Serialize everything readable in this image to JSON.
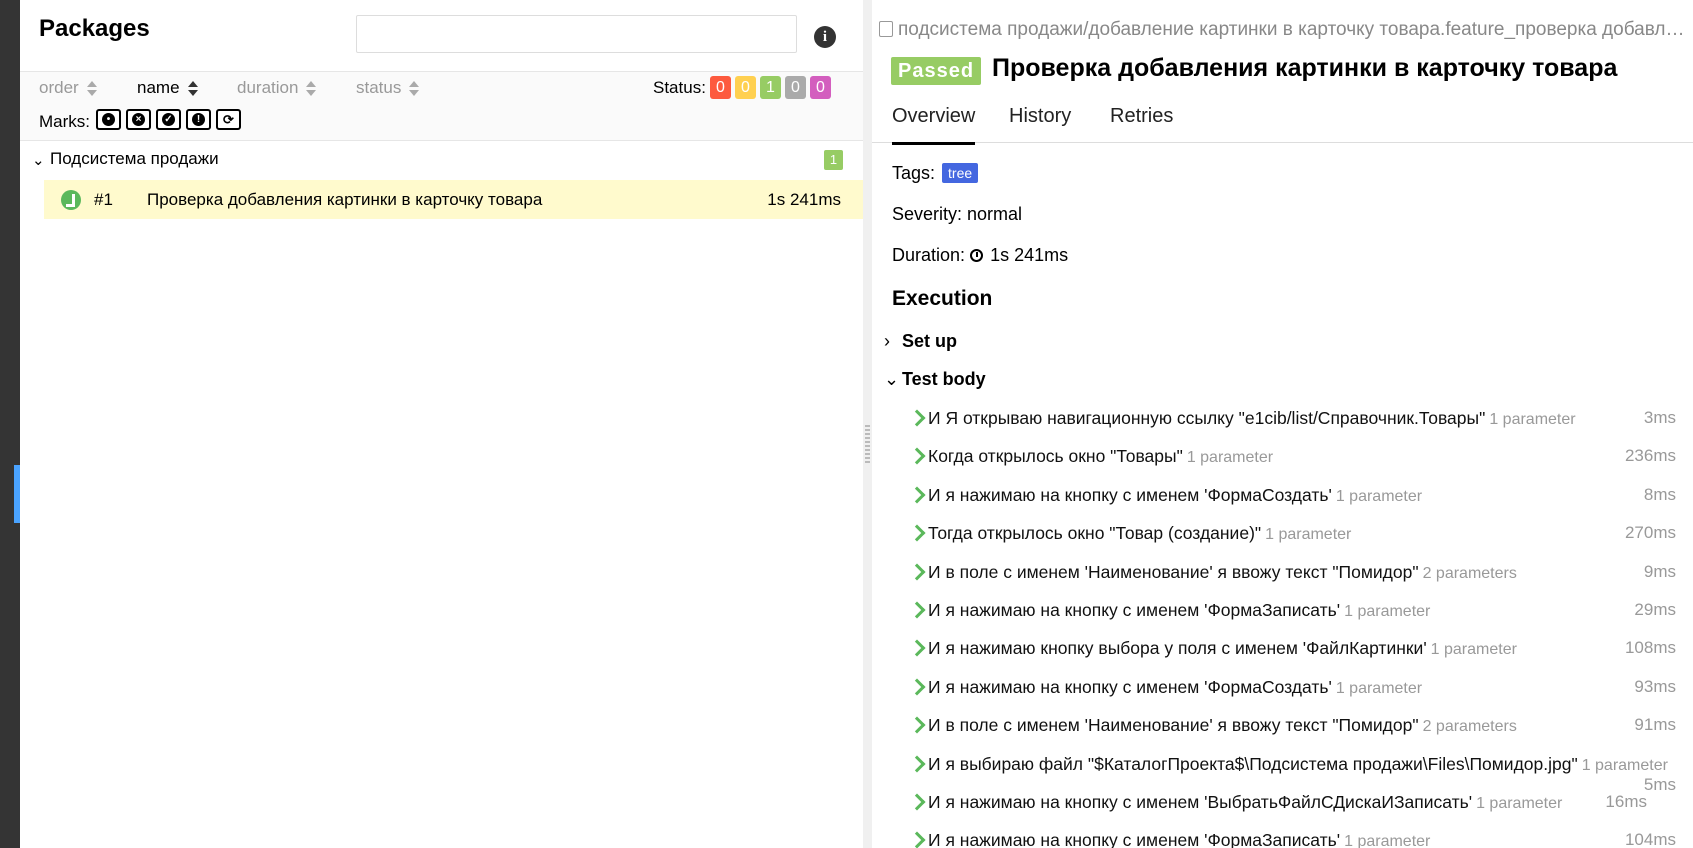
{
  "packages": {
    "title": "Packages",
    "search_placeholder": "",
    "sort": [
      {
        "label": "order"
      },
      {
        "label": "name"
      },
      {
        "label": "duration"
      },
      {
        "label": "status"
      }
    ],
    "status_label": "Status:",
    "status_counts": [
      {
        "value": "0",
        "color": "#fd5a3e"
      },
      {
        "value": "0",
        "color": "#ffd050"
      },
      {
        "value": "1",
        "color": "#97cc64"
      },
      {
        "value": "0",
        "color": "#aaaaaa"
      },
      {
        "value": "0",
        "color": "#d35ebe"
      }
    ],
    "marks_label": "Marks:",
    "marks": [
      "bomb-icon",
      "times-circle-icon",
      "check-circle-icon",
      "exclamation-circle-icon",
      "refresh-icon"
    ],
    "group": {
      "name": "Подсистема продажи",
      "count": "1"
    },
    "test": {
      "number": "#1",
      "name": "Проверка добавления картинки в карточку товара",
      "duration": "1s 241ms"
    }
  },
  "detail": {
    "breadcrumb": "подсистема продажи/добавление картинки в карточку товара.feature_проверка добавления картинки в карточку товара",
    "status": "Passed",
    "title": "Проверка добавления картинки в карточку товара",
    "tabs": [
      "Overview",
      "History",
      "Retries"
    ],
    "tags_label": "Tags:",
    "tag": "tree",
    "severity": "Severity: normal",
    "duration_label": "Duration:",
    "duration": "1s 241ms",
    "execution": "Execution",
    "setup": "Set up",
    "test_body": "Test body",
    "steps": [
      {
        "text": "И Я открываю навигационную ссылку \"e1cib/list/Справочник.Товары\"",
        "params": "1 parameter",
        "time": "3ms"
      },
      {
        "text": "Когда открылось окно \"Товары\"",
        "params": "1 parameter",
        "time": "236ms"
      },
      {
        "text": "И я нажимаю на кнопку с именем 'ФормаСоздать'",
        "params": "1 parameter",
        "time": "8ms"
      },
      {
        "text": "Тогда открылось окно \"Товар (создание)\"",
        "params": "1 parameter",
        "time": "270ms"
      },
      {
        "text": "И в поле с именем 'Наименование' я ввожу текст \"Помидор\"",
        "params": "2 parameters",
        "time": "9ms"
      },
      {
        "text": "И я нажимаю на кнопку с именем 'ФормаЗаписать'",
        "params": "1 parameter",
        "time": "29ms"
      },
      {
        "text": "И я нажимаю кнопку выбора у поля с именем 'ФайлКартинки'",
        "params": "1 parameter",
        "time": "108ms"
      },
      {
        "text": "И я нажимаю на кнопку с именем 'ФормаСоздать'",
        "params": "1 parameter",
        "time": "93ms"
      },
      {
        "text": "И в поле с именем 'Наименование' я ввожу текст \"Помидор\"",
        "params": "2 parameters",
        "time": "91ms"
      },
      {
        "text": "И я выбираю файл \"$КаталогПроекта$\\Подсистема продажи\\Files\\Помидор.jpg\"",
        "params": "1 parameter",
        "time": "5ms"
      },
      {
        "text": "И я нажимаю на кнопку с именем 'ВыбратьФайлСДискаИЗаписать'",
        "params": "1 parameter",
        "time": "16ms"
      },
      {
        "text": "И я нажимаю на кнопку с именем 'ФормаЗаписать'",
        "params": "1 parameter",
        "time": "104ms"
      }
    ]
  }
}
